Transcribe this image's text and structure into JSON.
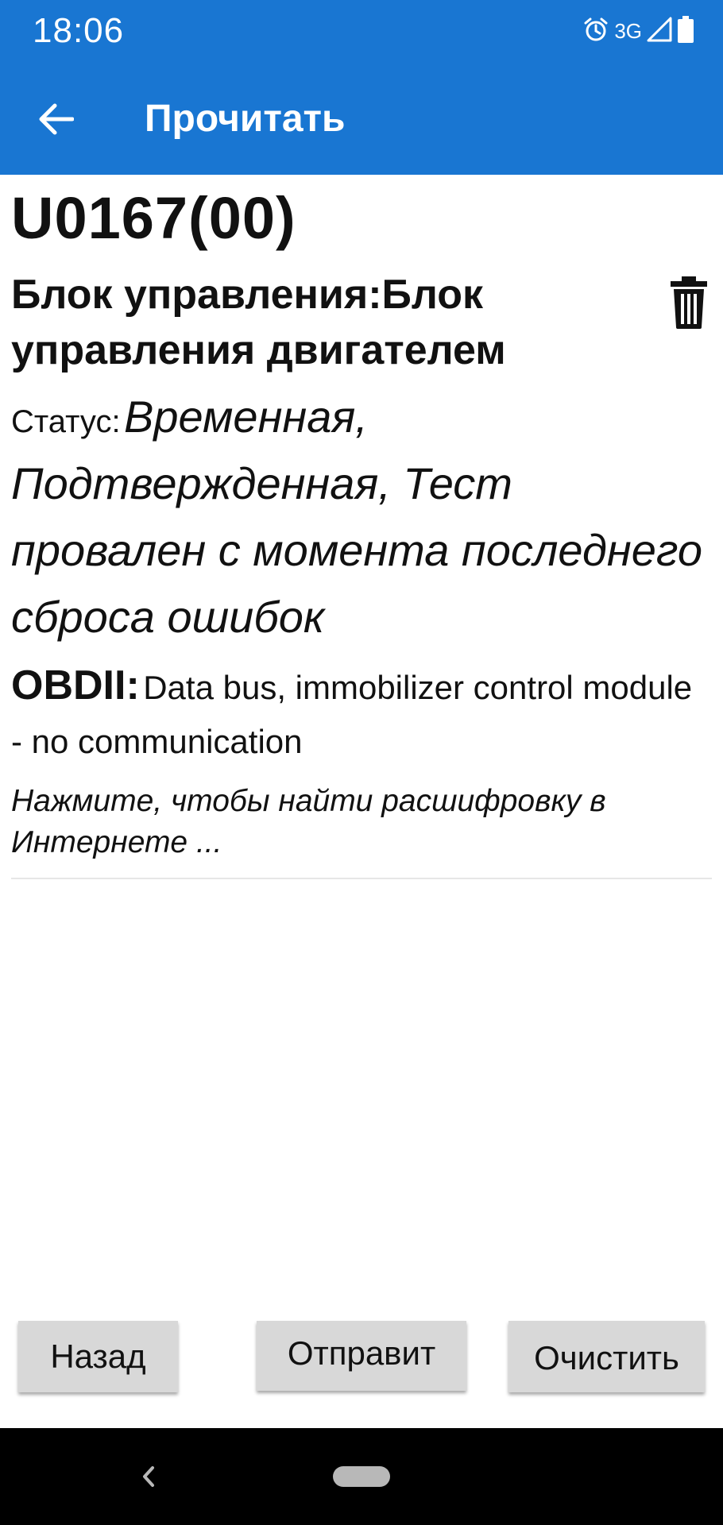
{
  "status_bar": {
    "time": "18:06",
    "network": "3G",
    "icons": [
      "alarm-icon",
      "signal-icon",
      "battery-icon"
    ]
  },
  "app_bar": {
    "title": "Прочитать",
    "back_icon": "arrow-left-icon"
  },
  "error": {
    "code": "U0167(00)",
    "unit": "Блок управления:Блок управления двигателем",
    "status_label": "Статус:",
    "status_value": "Временная, Подтвержденная, Тест провален с момента последнего сброса ошибок",
    "obd_label": "OBDII:",
    "obd_text": "Data bus, immobilizer control module - no communication",
    "search_hint": "Нажмите, чтобы найти расшифровку в Интернете ...",
    "delete_icon": "trash-icon"
  },
  "buttons": {
    "back": "Назад",
    "send": "Отправит",
    "clear": "Очистить"
  },
  "colors": {
    "accent": "#1976d2",
    "button_bg": "#d8d8d8",
    "nav_bg": "#000000"
  }
}
